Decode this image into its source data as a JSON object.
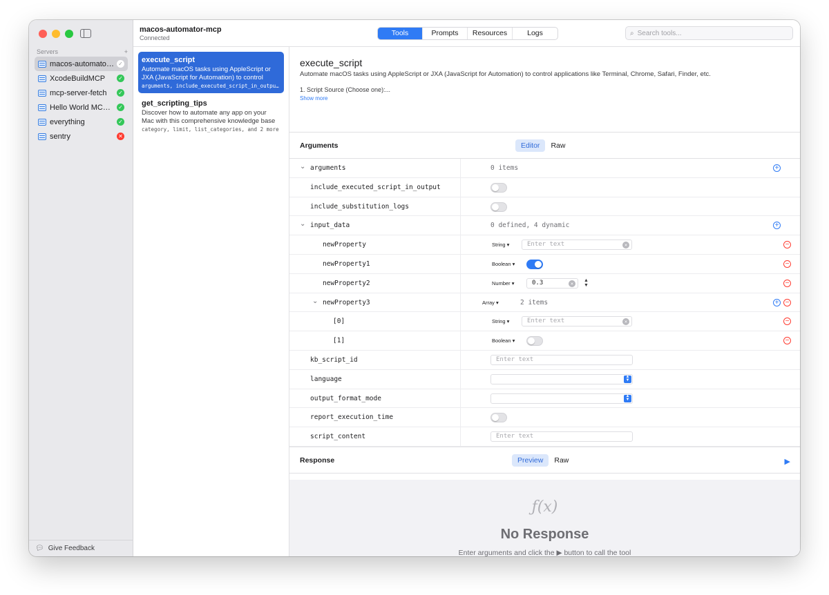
{
  "sidebar": {
    "section_label": "Servers",
    "add_label": "+",
    "servers": [
      {
        "name": "macos-automator-mcp",
        "status": "connected"
      },
      {
        "name": "XcodeBuildMCP",
        "status": "ok"
      },
      {
        "name": "mcp-server-fetch",
        "status": "ok"
      },
      {
        "name": "Hello World MCP Server",
        "status": "ok"
      },
      {
        "name": "everything",
        "status": "ok"
      },
      {
        "name": "sentry",
        "status": "error"
      }
    ],
    "feedback_label": "Give Feedback"
  },
  "toolbar": {
    "server_title": "macos-automator-mcp",
    "server_status": "Connected",
    "tabs": [
      "Tools",
      "Prompts",
      "Resources",
      "Logs"
    ],
    "active_tab": "Tools",
    "search_placeholder": "Search tools..."
  },
  "tools": [
    {
      "name": "execute_script",
      "description": "Automate macOS tasks using AppleScript or JXA (JavaScript for Automation) to control applications like Terminal, Chrome, Safari, Finder, etc.",
      "params": "arguments, include_executed_script_in_output, include_substitution_logs"
    },
    {
      "name": "get_scripting_tips",
      "description": "Discover how to automate any app on your Mac with this comprehensive knowledge base of scripting tips",
      "params": "category, limit, list_categories, and 2 more"
    }
  ],
  "detail": {
    "title": "execute_script",
    "description": "Automate macOS tasks using AppleScript or JXA (JavaScript for Automation) to control applications like Terminal, Chrome, Safari, Finder, etc.",
    "source_line": "1. Script Source (Choose one):...",
    "show_more": "Show more"
  },
  "arguments": {
    "title": "Arguments",
    "modes": [
      "Editor",
      "Raw"
    ],
    "params": {
      "arguments": "arguments",
      "arguments_value": "0 items",
      "include_executed": "include_executed_script_in_output",
      "include_substitution": "include_substitution_logs",
      "input_data": "input_data",
      "input_data_value": "0 defined, 4 dynamic",
      "new_prop": "newProperty",
      "new_prop_type": "String",
      "new_prop1": "newProperty1",
      "new_prop1_type": "Boolean",
      "new_prop2": "newProperty2",
      "new_prop2_type": "Number",
      "new_prop2_value": "0.3",
      "new_prop3": "newProperty3",
      "new_prop3_type": "Array",
      "new_prop3_value": "2 items",
      "item0": "[0]",
      "item0_type": "String",
      "item1": "[1]",
      "item1_type": "Boolean",
      "kb_script_id": "kb_script_id",
      "language": "language",
      "output_format_mode": "output_format_mode",
      "report_execution_time": "report_execution_time",
      "script_content": "script_content"
    },
    "placeholder": "Enter text"
  },
  "response": {
    "title": "Response",
    "modes": [
      "Preview",
      "Raw"
    ],
    "fx": "ƒ(x)",
    "empty_title": "No Response",
    "empty_hint": "Enter arguments and click the ▶ button to call the tool"
  }
}
